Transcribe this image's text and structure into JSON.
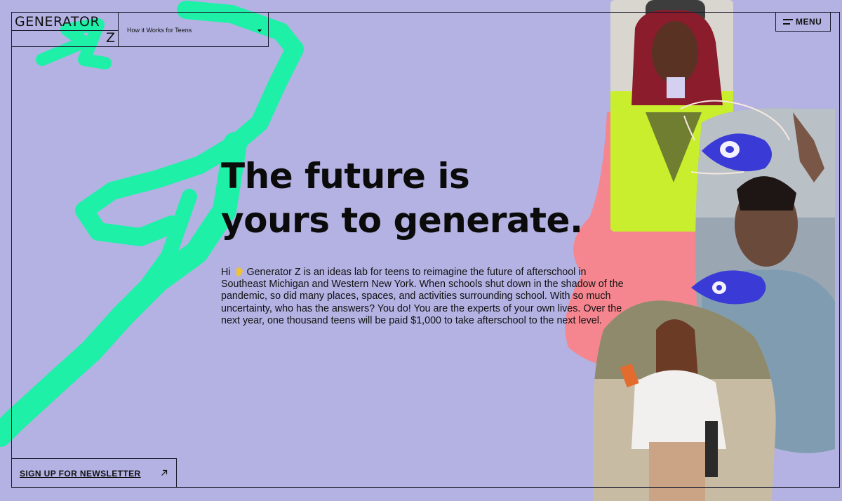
{
  "brand": {
    "line1": "GENERATOR",
    "line2": "Z"
  },
  "audience_select": {
    "label": "How it Works for Teens"
  },
  "menu": {
    "label": "MENU"
  },
  "hero": {
    "headline_line1": "The future is",
    "headline_line2": "yours to generate.",
    "intro_prefix": "Hi",
    "intro_emoji_name": "waving-hand-icon",
    "intro_body": "Generator Z is an ideas lab for teens to reimagine the future of afterschool in Southeast Michigan and Western New York. When schools shut down in the shadow of the pandemic, so did many places, spaces, and activities surrounding school. With so much uncertainty, who has the answers? You do! You are the experts of your own lives. Over the next year, one thousand teens will be paid $1,000 to take afterschool to the next level."
  },
  "newsletter": {
    "label": "SIGN UP FOR NEWSLETTER"
  },
  "colors": {
    "background": "#b3b2e3",
    "scribble": "#1ff0a8",
    "collage_pink": "#f5868f",
    "ink": "#111111",
    "eye_blue": "#3a3ad6"
  }
}
